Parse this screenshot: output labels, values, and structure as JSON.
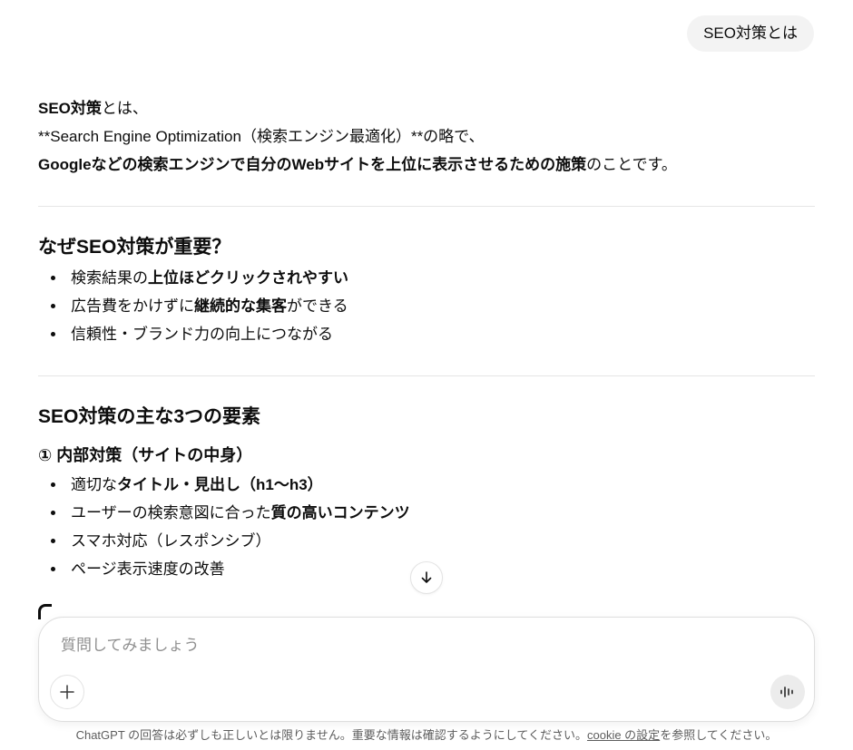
{
  "user_message": "SEO対策とは",
  "answer": {
    "intro_bold1": "SEO対策",
    "intro_rest1": "とは、",
    "intro_line2": "**Search Engine Optimization（検索エンジン最適化）**の略で、",
    "intro_bold3": "Googleなどの検索エンジンで自分のWebサイトを上位に表示させるための施策",
    "intro_rest3": "のことです。",
    "section1": {
      "heading": "なぜSEO対策が重要？",
      "items": [
        {
          "pre": "検索結果の",
          "bold": "上位ほどクリックされやすい",
          "post": ""
        },
        {
          "pre": "広告費をかけずに",
          "bold": "継続的な集客",
          "post": "ができる"
        },
        {
          "pre": "信頼性・ブランド力の向上につながる",
          "bold": "",
          "post": ""
        }
      ]
    },
    "section2": {
      "heading": "SEO対策の主な3つの要素",
      "sub1": {
        "heading": "① 内部対策（サイトの中身）",
        "items": [
          {
            "pre": "適切な",
            "bold": "タイトル・見出し（h1〜h3）",
            "post": ""
          },
          {
            "pre": "ユーザーの検索意図に合った",
            "bold": "質の高いコンテンツ",
            "post": ""
          },
          {
            "pre": "スマホ対応（レスポンシブ）",
            "bold": "",
            "post": ""
          },
          {
            "pre": "ページ表示速度の改善",
            "bold": "",
            "post": ""
          }
        ]
      }
    }
  },
  "composer": {
    "placeholder": "質問してみましょう"
  },
  "icons": {
    "scroll": "arrow-down-icon",
    "add": "plus-icon",
    "voice": "voice-mode-icon"
  },
  "disclaimer": {
    "pre": "ChatGPT の回答は必ずしも正しいとは限りません。重要な情報は確認するようにしてください。",
    "link": "cookie の設定",
    "post": "を参照してください。"
  }
}
